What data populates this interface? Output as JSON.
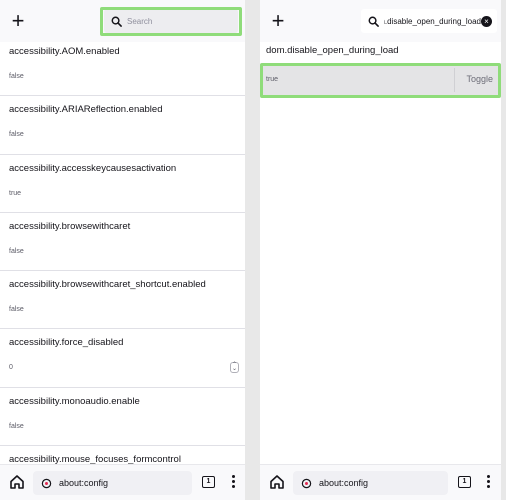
{
  "left": {
    "new_pref_icon": "+",
    "search": {
      "placeholder": "Search"
    },
    "prefs": [
      {
        "name": "accessibility.AOM.enabled",
        "value": "false"
      },
      {
        "name": "accessibility.ARIAReflection.enabled",
        "value": "false"
      },
      {
        "name": "accessibility.accesskeycausesactivation",
        "value": "true"
      },
      {
        "name": "accessibility.browsewithcaret",
        "value": "false"
      },
      {
        "name": "accessibility.browsewithcaret_shortcut.enabled",
        "value": "false"
      },
      {
        "name": "accessibility.force_disabled",
        "value": "0"
      },
      {
        "name": "accessibility.monoaudio.enable",
        "value": "false"
      },
      {
        "name": "accessibility.mouse_focuses_formcontrol",
        "value": ""
      }
    ],
    "url": "about:config",
    "tab_count": "1"
  },
  "right": {
    "new_pref_icon": "+",
    "search": {
      "value": "dom.disable_open_during_load",
      "clear_icon": "×"
    },
    "pref_name": "dom.disable_open_during_load",
    "pref_value": "true",
    "toggle_label": "Toggle",
    "url": "about:config",
    "tab_count": "1"
  },
  "colors": {
    "highlight": "#8fdc7a",
    "row_selected": "#e4e4e6"
  },
  "icons": [
    "plus-icon",
    "search-icon",
    "clear-icon",
    "home-icon",
    "firefox-icon",
    "tabs-icon",
    "menu-icon",
    "spinner-icon"
  ]
}
